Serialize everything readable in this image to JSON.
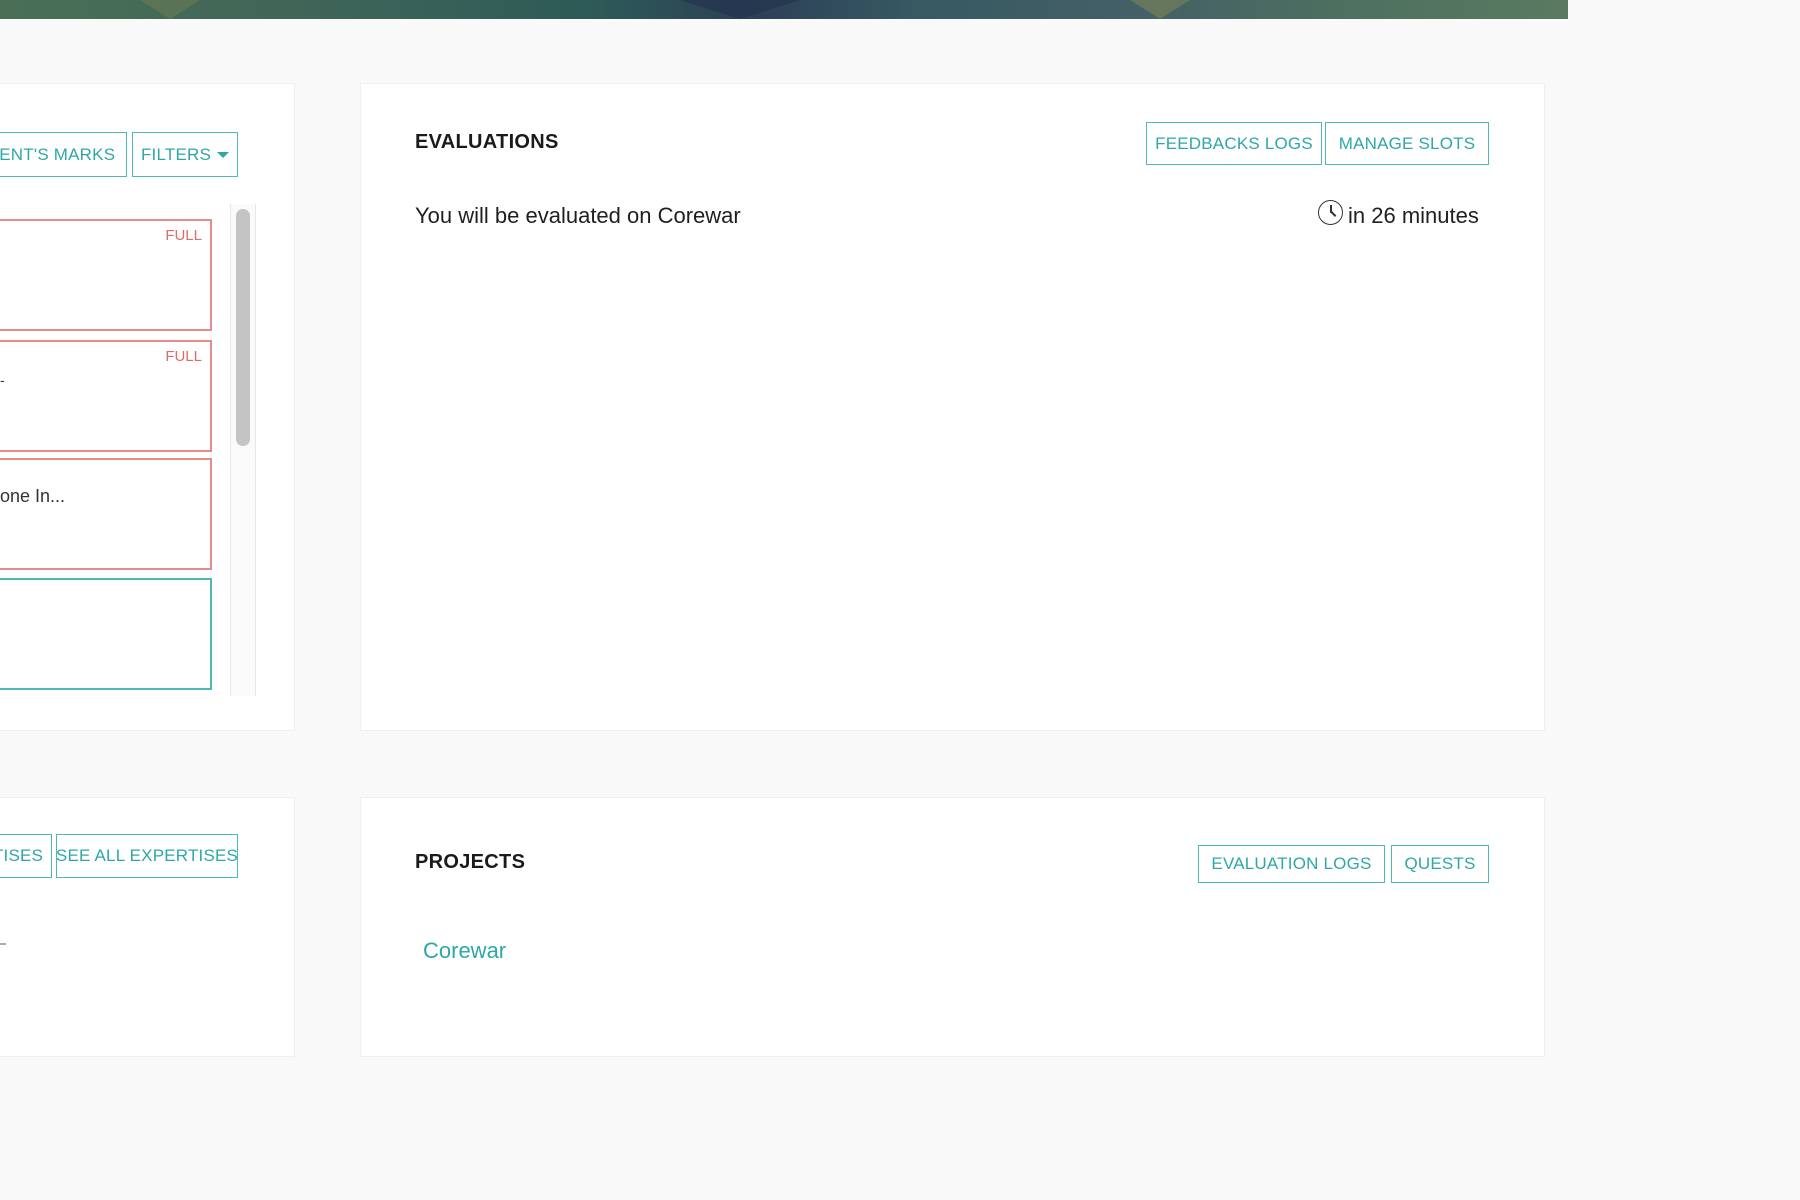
{
  "left_card": {
    "buttons": {
      "marks_label": "VENT'S MARKS",
      "filters_label": "FILTERS"
    },
    "slots": [
      {
        "status": "FULL",
        "partial_text": ""
      },
      {
        "status": "FULL",
        "partial_text": "-"
      },
      {
        "status": "",
        "partial_text": "one In..."
      },
      {
        "status": "",
        "partial_text": ""
      }
    ]
  },
  "evaluations": {
    "title": "EVALUATIONS",
    "feedbacks_logs_label": "FEEDBACKS LOGS",
    "manage_slots_label": "MANAGE SLOTS",
    "item_text": "You will be evaluated on Corewar",
    "item_time": "in 26 minutes",
    "item_icon": "clock-icon"
  },
  "expertises_card": {
    "expertises_label": "TISES",
    "see_all_label": "SEE ALL EXPERTISES"
  },
  "projects": {
    "title": "PROJECTS",
    "evaluation_logs_label": "EVALUATION LOGS",
    "quests_label": "QUESTS",
    "items": [
      "Corewar"
    ]
  },
  "colors": {
    "accent": "#2ea7a7",
    "full_border": "#e88a8a",
    "full_text": "#e06a6a"
  }
}
